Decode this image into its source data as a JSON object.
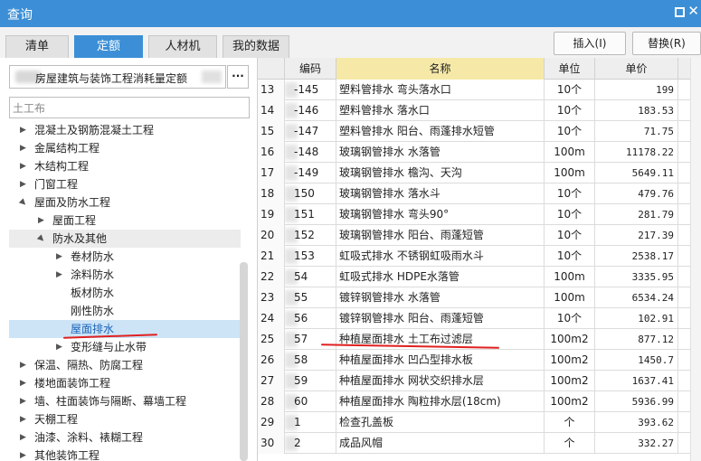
{
  "window": {
    "title": "查询"
  },
  "tabs": [
    {
      "label": "清单",
      "active": false
    },
    {
      "label": "定额",
      "active": true
    },
    {
      "label": "人材机",
      "active": false
    },
    {
      "label": "我的数据",
      "active": false
    }
  ],
  "toolbar": {
    "insert_label": "插入(I)",
    "replace_label": "替换(R)"
  },
  "library": {
    "selected": "房屋建筑与装饰工程消耗量定额",
    "more_label": "···"
  },
  "search": {
    "value": "土工布"
  },
  "tree": [
    {
      "label": "混凝土及钢筋混凝土工程",
      "level": 1,
      "expand": "collapsed"
    },
    {
      "label": "金属结构工程",
      "level": 1,
      "expand": "collapsed"
    },
    {
      "label": "木结构工程",
      "level": 1,
      "expand": "collapsed"
    },
    {
      "label": "门窗工程",
      "level": 1,
      "expand": "collapsed"
    },
    {
      "label": "屋面及防水工程",
      "level": 1,
      "expand": "expanded"
    },
    {
      "label": "屋面工程",
      "level": 2,
      "expand": "collapsed"
    },
    {
      "label": "防水及其他",
      "level": 2,
      "expand": "expanded",
      "highlight": "gray"
    },
    {
      "label": "卷材防水",
      "level": 3,
      "expand": "collapsed"
    },
    {
      "label": "涂料防水",
      "level": 3,
      "expand": "collapsed"
    },
    {
      "label": "板材防水",
      "level": 3,
      "expand": "none"
    },
    {
      "label": "刚性防水",
      "level": 3,
      "expand": "none"
    },
    {
      "label": "屋面排水",
      "level": 3,
      "expand": "none",
      "highlight": "blue"
    },
    {
      "label": "变形缝与止水带",
      "level": 3,
      "expand": "collapsed"
    },
    {
      "label": "保温、隔热、防腐工程",
      "level": 1,
      "expand": "collapsed"
    },
    {
      "label": "楼地面装饰工程",
      "level": 1,
      "expand": "collapsed"
    },
    {
      "label": "墙、柱面装饰与隔断、幕墙工程",
      "level": 1,
      "expand": "collapsed"
    },
    {
      "label": "天棚工程",
      "level": 1,
      "expand": "collapsed"
    },
    {
      "label": "油漆、涂料、裱糊工程",
      "level": 1,
      "expand": "collapsed"
    },
    {
      "label": "其他装饰工程",
      "level": 1,
      "expand": "collapsed"
    }
  ],
  "grid": {
    "headers": {
      "code": "编码",
      "name": "名称",
      "unit": "单位",
      "price": "单价"
    },
    "rows": [
      {
        "num": "13",
        "code": "-145",
        "name": "塑料管排水 弯头落水口",
        "unit": "10个",
        "price": "199"
      },
      {
        "num": "14",
        "code": "-146",
        "name": "塑料管排水 落水口",
        "unit": "10个",
        "price": "183.53"
      },
      {
        "num": "15",
        "code": "-147",
        "name": "塑料管排水 阳台、雨蓬排水短管",
        "unit": "10个",
        "price": "71.75"
      },
      {
        "num": "16",
        "code": "-148",
        "name": "玻璃钢管排水 水落管",
        "unit": "100m",
        "price": "11178.22"
      },
      {
        "num": "17",
        "code": "-149",
        "name": "玻璃钢管排水 檐沟、天沟",
        "unit": "100m",
        "price": "5649.11"
      },
      {
        "num": "18",
        "code": "150",
        "name": "玻璃钢管排水 落水斗",
        "unit": "10个",
        "price": "479.76"
      },
      {
        "num": "19",
        "code": "151",
        "name": "玻璃钢管排水 弯头90°",
        "unit": "10个",
        "price": "281.79"
      },
      {
        "num": "20",
        "code": "152",
        "name": "玻璃钢管排水 阳台、雨蓬短管",
        "unit": "10个",
        "price": "217.39"
      },
      {
        "num": "21",
        "code": "153",
        "name": "虹吸式排水 不锈钢虹吸雨水斗",
        "unit": "10个",
        "price": "2538.17"
      },
      {
        "num": "22",
        "code": "54",
        "name": "虹吸式排水 HDPE水落管",
        "unit": "100m",
        "price": "3335.95"
      },
      {
        "num": "23",
        "code": "55",
        "name": "镀锌钢管排水 水落管",
        "unit": "100m",
        "price": "6534.24"
      },
      {
        "num": "24",
        "code": "56",
        "name": "镀锌钢管排水 阳台、雨蓬短管",
        "unit": "10个",
        "price": "102.91"
      },
      {
        "num": "25",
        "code": "57",
        "name": "种植屋面排水 土工布过滤层",
        "unit": "100m2",
        "price": "877.12"
      },
      {
        "num": "26",
        "code": "58",
        "name": "种植屋面排水 凹凸型排水板",
        "unit": "100m2",
        "price": "1450.7"
      },
      {
        "num": "27",
        "code": "59",
        "name": "种植屋面排水 网状交织排水层",
        "unit": "100m2",
        "price": "1637.41"
      },
      {
        "num": "28",
        "code": "60",
        "name": "种植屋面排水 陶粒排水层(18cm)",
        "unit": "100m2",
        "price": "5936.99"
      },
      {
        "num": "29",
        "code": "1",
        "name": "检查孔盖板",
        "unit": "个",
        "price": "393.62"
      },
      {
        "num": "30",
        "code": "2",
        "name": "成品风帽",
        "unit": "个",
        "price": "332.27"
      }
    ]
  }
}
